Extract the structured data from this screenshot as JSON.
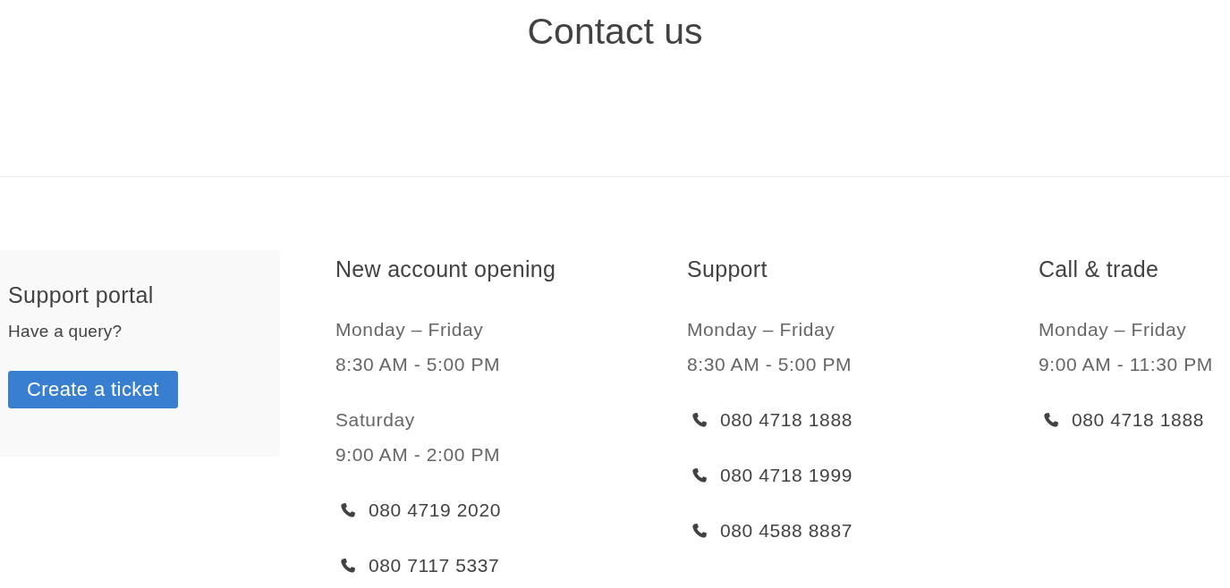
{
  "page": {
    "title": "Contact us"
  },
  "support_portal": {
    "title": "Support portal",
    "subtitle": "Have a query?",
    "button": "Create a ticket"
  },
  "sections": [
    {
      "title": "New account opening",
      "hours": [
        {
          "days": "Monday – Friday",
          "time": "8:30 AM - 5:00 PM"
        },
        {
          "days": "Saturday",
          "time": "9:00 AM - 2:00 PM"
        }
      ],
      "phones": [
        "080 4719 2020",
        "080 7117 5337"
      ]
    },
    {
      "title": "Support",
      "hours": [
        {
          "days": "Monday – Friday",
          "time": "8:30 AM - 5:00 PM"
        }
      ],
      "phones": [
        "080 4718 1888",
        "080 4718 1999",
        "080 4588 8887"
      ]
    },
    {
      "title": "Call & trade",
      "hours": [
        {
          "days": "Monday – Friday",
          "time": "9:00 AM - 11:30 PM"
        }
      ],
      "phones": [
        "080 4718 1888"
      ]
    }
  ]
}
